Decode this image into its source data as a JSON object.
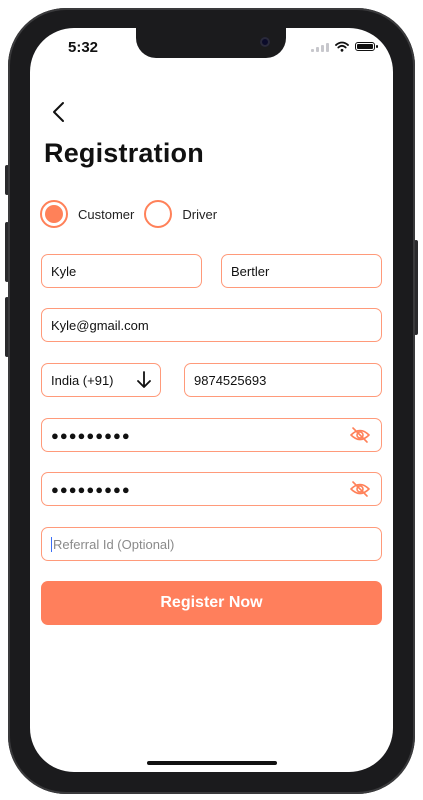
{
  "status_bar": {
    "time": "5:32"
  },
  "header": {
    "title": "Registration"
  },
  "role_selector": {
    "options": [
      {
        "label": "Customer",
        "selected": true
      },
      {
        "label": "Driver",
        "selected": false
      }
    ]
  },
  "form": {
    "first_name": "Kyle",
    "last_name": "Bertler",
    "email": "Kyle@gmail.com",
    "country_code": "India (+91)",
    "phone": "9874525693",
    "password_masked": "●●●●●●●●●",
    "confirm_password_masked": "●●●●●●●●●",
    "referral_placeholder": "Referral Id (Optional)"
  },
  "actions": {
    "register_label": "Register Now"
  },
  "colors": {
    "accent": "#ff7f5c",
    "field_border": "#ff9a7a",
    "text": "#111111"
  },
  "icons": [
    "back-arrow-icon",
    "down-arrow-icon",
    "eye-off-icon"
  ]
}
